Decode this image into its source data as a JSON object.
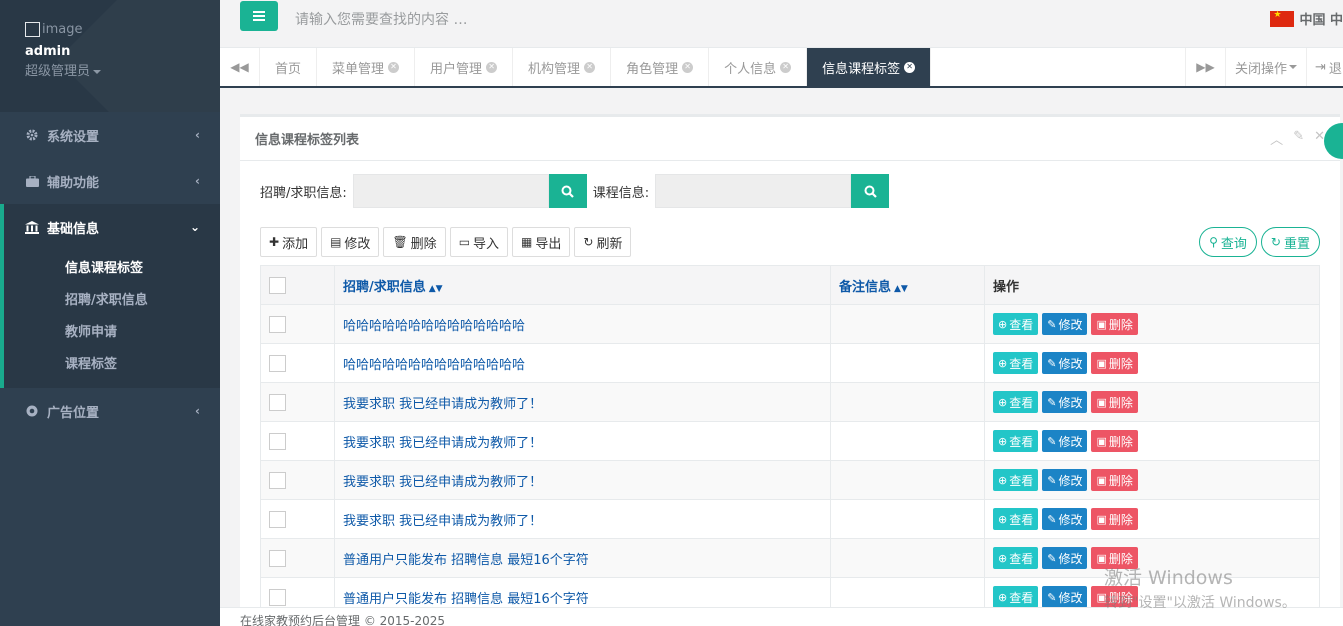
{
  "profile": {
    "image_alt": "image",
    "username": "admin",
    "role": "超级管理员"
  },
  "sidebar": {
    "items": [
      {
        "label": "系统设置",
        "icon": "gear-icon"
      },
      {
        "label": "辅助功能",
        "icon": "briefcase-icon"
      },
      {
        "label": "基础信息",
        "icon": "bank-icon"
      },
      {
        "label": "广告位置",
        "icon": "chrome-icon"
      }
    ],
    "sub_items": [
      "信息课程标签",
      "招聘/求职信息",
      "教师申请",
      "课程标签"
    ]
  },
  "topbar": {
    "search_placeholder": "请输入您需要查找的内容 …",
    "lang_label": "中国 中"
  },
  "tabs": {
    "items": [
      "首页",
      "菜单管理",
      "用户管理",
      "机构管理",
      "角色管理",
      "个人信息",
      "信息课程标签"
    ],
    "close_ops": "关闭操作",
    "exit": "退"
  },
  "panel": {
    "title": "信息课程标签列表",
    "filter1_label": "招聘/求职信息:",
    "filter2_label": "课程信息:",
    "toolbar": {
      "add": "添加",
      "edit": "修改",
      "delete": "删除",
      "import": "导入",
      "export": "导出",
      "refresh": "刷新"
    },
    "query": "查询",
    "reset": "重置"
  },
  "table": {
    "headers": [
      "招聘/求职信息",
      "备注信息",
      "操作"
    ],
    "rows": [
      {
        "info": "哈哈哈哈哈哈哈哈哈哈哈哈哈哈",
        "note": ""
      },
      {
        "info": "哈哈哈哈哈哈哈哈哈哈哈哈哈哈",
        "note": ""
      },
      {
        "info": "我要求职 我已经申请成为教师了！",
        "note": ""
      },
      {
        "info": "我要求职 我已经申请成为教师了！",
        "note": ""
      },
      {
        "info": "我要求职 我已经申请成为教师了！",
        "note": ""
      },
      {
        "info": "我要求职 我已经申请成为教师了！",
        "note": ""
      },
      {
        "info": "普通用户只能发布 招聘信息 最短16个字符",
        "note": ""
      },
      {
        "info": "普通用户只能发布 招聘信息 最短16个字符",
        "note": ""
      }
    ],
    "actions": {
      "view": "查看",
      "edit": "修改",
      "delete": "删除"
    }
  },
  "footer": {
    "text": "在线家教预约后台管理 © 2015-2025"
  },
  "watermark": {
    "line1": "激活 Windows",
    "line2": "转到\"设置\"以激活 Windows。"
  },
  "colors": {
    "sidebar": "#2f4050",
    "accent": "#1ab394",
    "link": "#0e59a8",
    "view": "#23c6c8",
    "edit": "#1c84c6",
    "delete": "#ed5565"
  }
}
